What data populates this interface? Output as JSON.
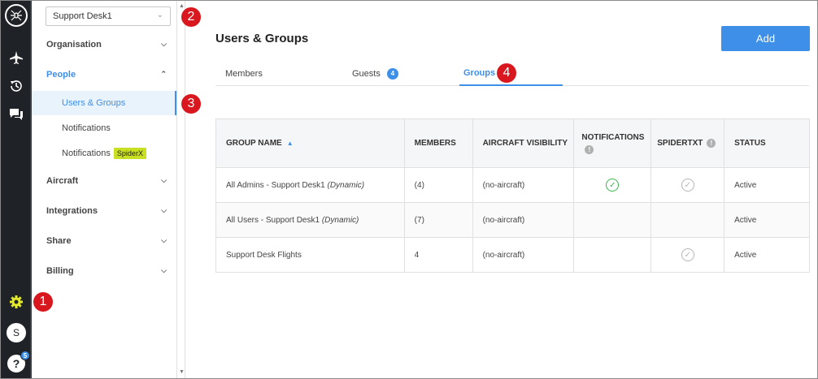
{
  "account_selector": {
    "value": "Support Desk1"
  },
  "rail": {
    "avatar_initial": "S",
    "help_label": "?",
    "help_badge": "5",
    "icons": [
      "spider-logo-icon",
      "airplane-icon",
      "history-icon",
      "chat-icon",
      "gear-icon"
    ]
  },
  "sidebar": {
    "organisation": "Organisation",
    "people": "People",
    "people_items": {
      "users_groups": "Users & Groups",
      "notifications": "Notifications",
      "notifications_spiderx": "Notifications",
      "spiderx_tag": "SpiderX"
    },
    "aircraft": "Aircraft",
    "integrations": "Integrations",
    "share": "Share",
    "billing": "Billing"
  },
  "callouts": {
    "c1": "1",
    "c2": "2",
    "c3": "3",
    "c4": "4"
  },
  "page": {
    "title": "Users & Groups",
    "add_label": "Add"
  },
  "tabs": {
    "members": "Members",
    "guests": "Guests",
    "guests_count": "4",
    "groups": "Groups"
  },
  "table": {
    "headers": {
      "group_name": "GROUP NAME",
      "members": "MEMBERS",
      "aircraft_visibility": "AIRCRAFT VISIBILITY",
      "notifications": "NOTIFICATIONS",
      "spidertxt": "SPIDERTXT",
      "status": "STATUS"
    },
    "rows": [
      {
        "name": "All Admins - Support Desk1",
        "suffix": "(Dynamic)",
        "members": "(4)",
        "aircraft": "(no-aircraft)",
        "status": "Active"
      },
      {
        "name": "All Users - Support Desk1",
        "suffix": "(Dynamic)",
        "members": "(7)",
        "aircraft": "(no-aircraft)",
        "status": "Active"
      },
      {
        "name": "Support Desk Flights",
        "suffix": "",
        "members": "4",
        "aircraft": "(no-aircraft)",
        "status": "Active"
      }
    ]
  },
  "colors": {
    "accent": "#3d8fe8",
    "callout": "#d8181e",
    "rail": "#1f2327",
    "tag": "#c8e021",
    "check_green": "#39b54a"
  }
}
